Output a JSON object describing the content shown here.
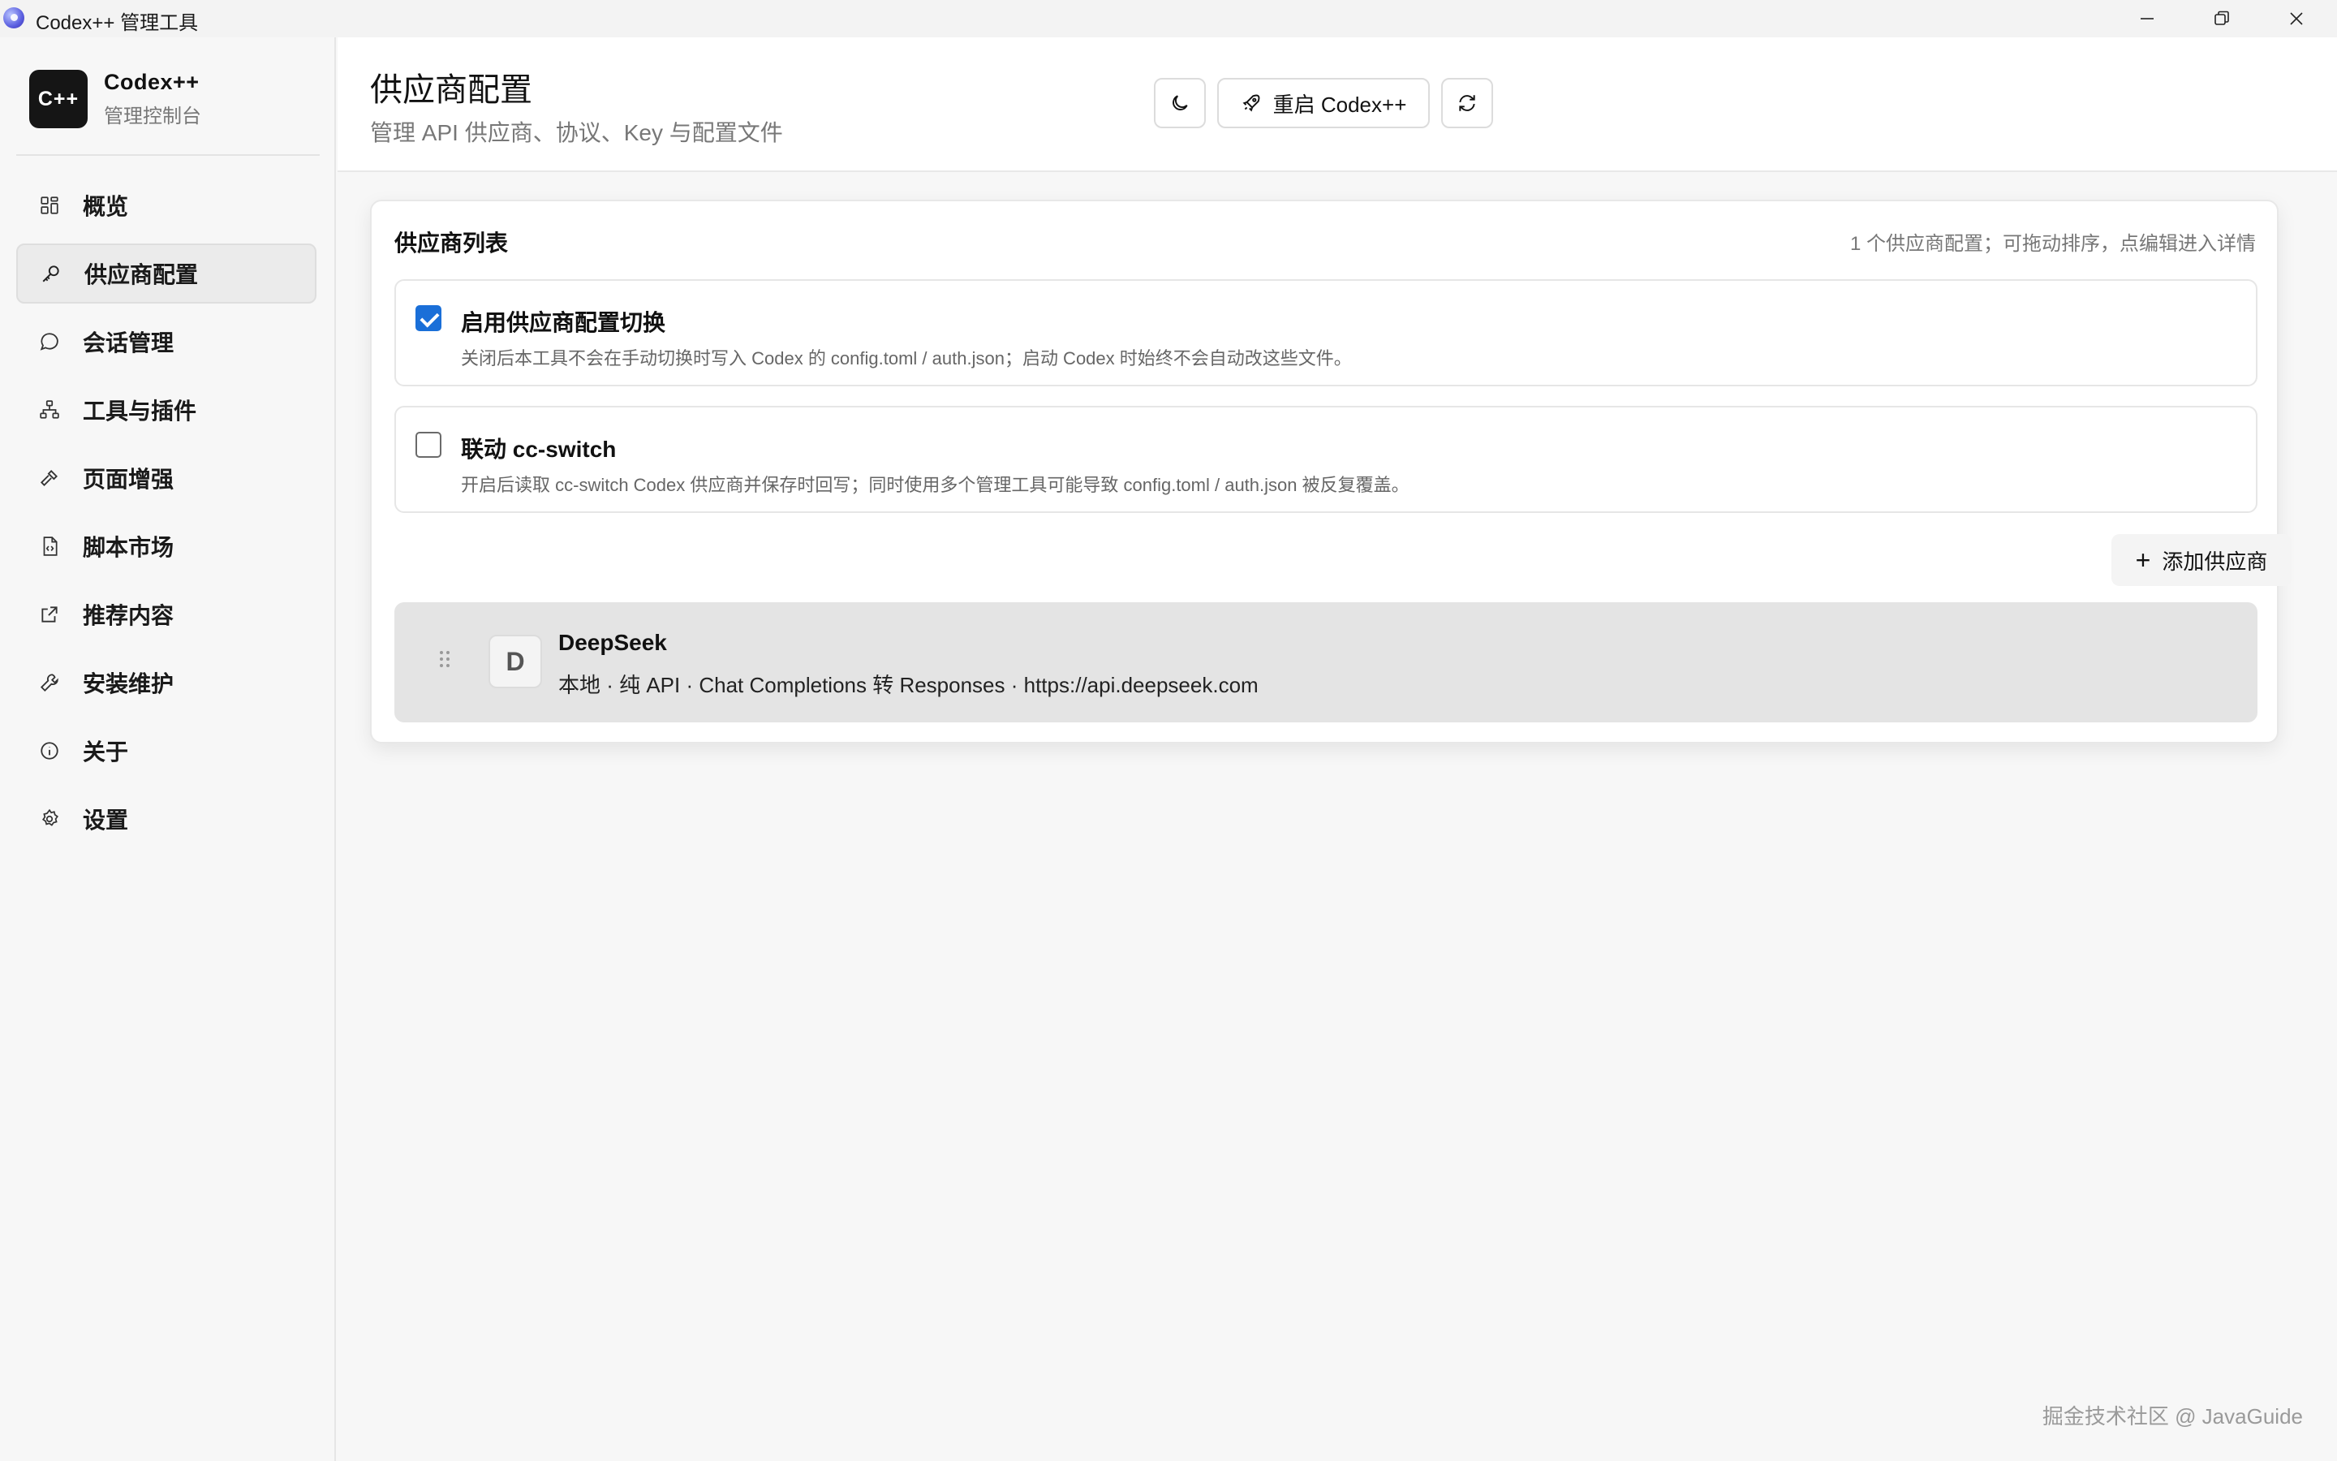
{
  "window": {
    "title": "Codex++ 管理工具"
  },
  "sidebar": {
    "brand_logo": "C++",
    "brand_name": "Codex++",
    "brand_sub": "管理控制台",
    "items": [
      {
        "label": "概览",
        "icon": "grid-icon"
      },
      {
        "label": "供应商配置",
        "icon": "key-icon",
        "active": true
      },
      {
        "label": "会话管理",
        "icon": "chat-bubble-icon"
      },
      {
        "label": "工具与插件",
        "icon": "network-icon"
      },
      {
        "label": "页面增强",
        "icon": "hammer-icon"
      },
      {
        "label": "脚本市场",
        "icon": "script-file-icon"
      },
      {
        "label": "推荐内容",
        "icon": "external-link-icon"
      },
      {
        "label": "安装维护",
        "icon": "wrench-icon"
      },
      {
        "label": "关于",
        "icon": "info-icon"
      },
      {
        "label": "设置",
        "icon": "gear-icon"
      }
    ]
  },
  "header": {
    "title": "供应商配置",
    "subtitle": "管理 API 供应商、协议、Key 与配置文件",
    "restart_label": "重启 Codex++"
  },
  "card": {
    "title": "供应商列表",
    "hint": "1 个供应商配置；可拖动排序，点编辑进入详情",
    "options": [
      {
        "checked": true,
        "title": "启用供应商配置切换",
        "desc": "关闭后本工具不会在手动切换时写入 Codex 的 config.toml / auth.json；启动 Codex 时始终不会自动改这些文件。"
      },
      {
        "checked": false,
        "title": "联动 cc-switch",
        "desc": "开启后读取 cc-switch Codex 供应商并保存时回写；同时使用多个管理工具可能导致 config.toml / auth.json 被反复覆盖。"
      }
    ],
    "add_label": "添加供应商",
    "providers": [
      {
        "initial": "D",
        "name": "DeepSeek",
        "meta": "本地 · 纯 API · Chat Completions 转 Responses · https://api.deepseek.com"
      }
    ]
  },
  "watermark": "掘金技术社区 @ JavaGuide"
}
